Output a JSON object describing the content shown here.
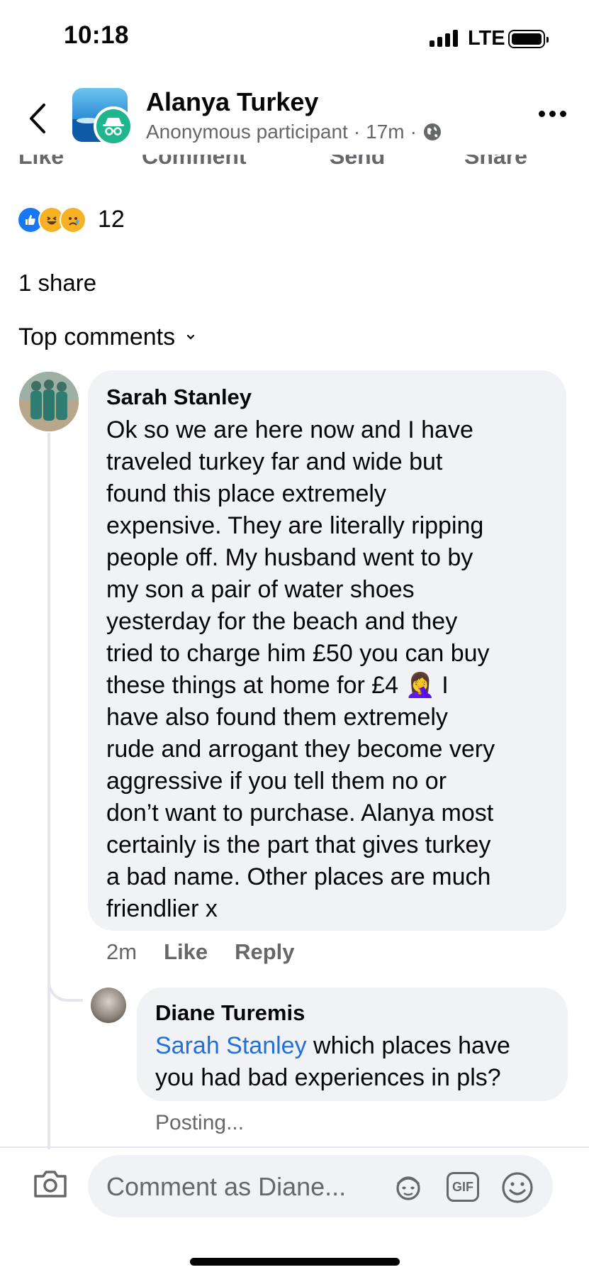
{
  "status_bar": {
    "time": "10:18",
    "network": "LTE"
  },
  "header": {
    "group_name": "Alanya Turkey",
    "author": "Anonymous participant",
    "separator": "·",
    "time_ago": "17m",
    "separator2": "·"
  },
  "post_actions": {
    "like": "Like",
    "comment": "Comment",
    "send": "Send",
    "share": "Share"
  },
  "reactions": {
    "count": "12",
    "types": [
      "like",
      "haha",
      "sad"
    ]
  },
  "shares": "1 share",
  "comments_header": "Top comments",
  "comments": [
    {
      "author": "Sarah Stanley",
      "text_lines": [
        "Ok so we are here now and I have",
        "traveled turkey far and wide but",
        "found this place extremely",
        "expensive. They are literally ripping",
        "people off. My husband went to by",
        "my son a pair of water shoes",
        "yesterday for the beach and they",
        "tried to charge him £50 you can buy",
        "these things at home for £4 🤦‍♀️ I",
        "have also found them extremely",
        "rude and arrogant they become very",
        "aggressive if you tell them no or",
        "don’t want to purchase. Alanya most",
        "certainly is the part that gives turkey",
        "a bad name. Other places are much",
        "friendlier x"
      ],
      "time": "2m",
      "like_label": "Like",
      "reply_label": "Reply"
    }
  ],
  "reply": {
    "author": "Diane Turemis",
    "mention": "Sarah Stanley",
    "text_line1": " which places have",
    "text_line2": "you had bad experiences in pls?",
    "status": "Posting..."
  },
  "composer": {
    "placeholder": "Comment as Diane...",
    "gif_label": "GIF"
  },
  "colors": {
    "mention": "#216fdb",
    "like_blue": "#1877f2",
    "bubble": "#f0f2f5",
    "muted": "#65676b"
  }
}
